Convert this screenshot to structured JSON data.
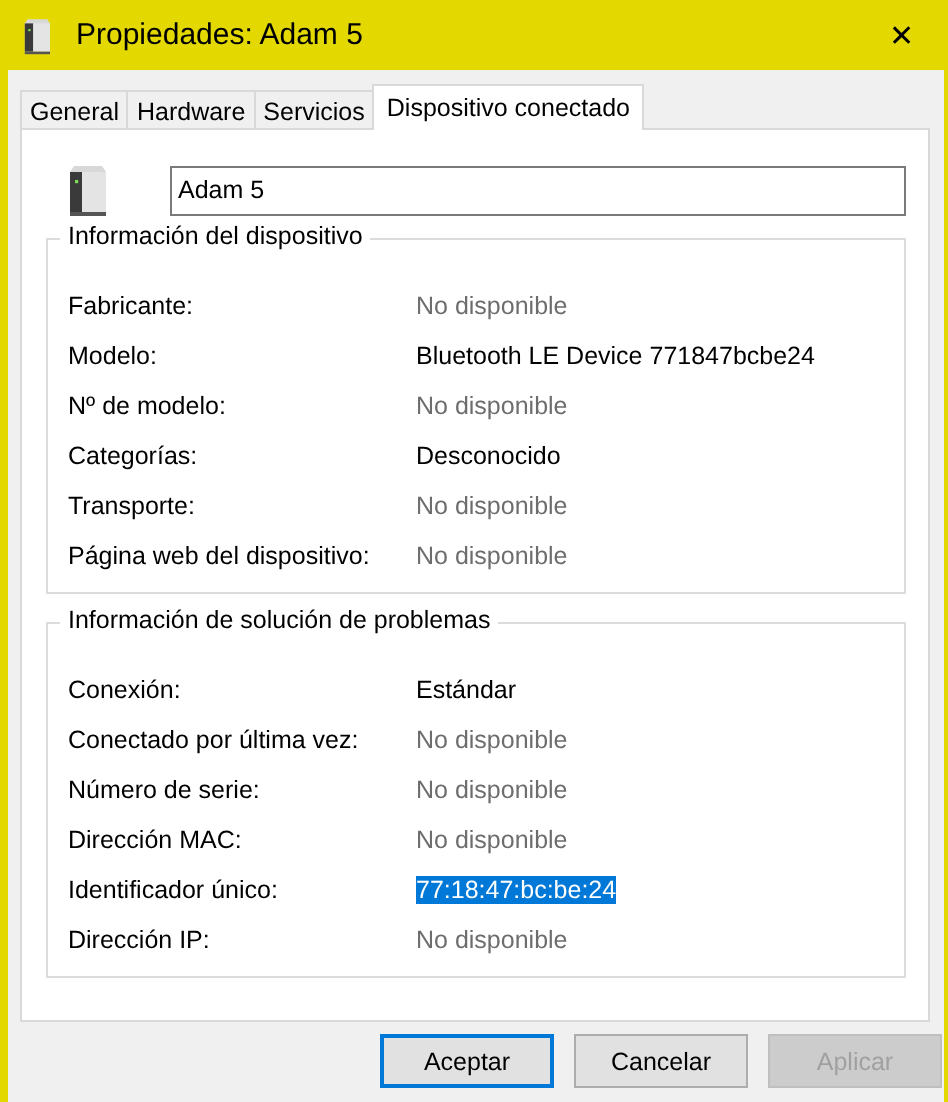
{
  "window": {
    "title": "Propiedades: Adam 5",
    "close": "✕"
  },
  "tabs": [
    {
      "label": "General",
      "selected": false
    },
    {
      "label": "Hardware",
      "selected": false
    },
    {
      "label": "Servicios",
      "selected": false
    },
    {
      "label": "Dispositivo conectado",
      "selected": true
    }
  ],
  "device_name": {
    "value": "Adam 5"
  },
  "groups": [
    {
      "title": "Información del dispositivo",
      "rows": [
        {
          "label": "Fabricante:",
          "value": "No disponible",
          "kind": "unavailable"
        },
        {
          "label": "Modelo:",
          "value": "Bluetooth LE Device 771847bcbe24",
          "kind": "text"
        },
        {
          "label": "Nº de modelo:",
          "value": "No disponible",
          "kind": "unavailable"
        },
        {
          "label": "Categorías:",
          "value": "Desconocido",
          "kind": "text"
        },
        {
          "label": "Transporte:",
          "value": "No disponible",
          "kind": "unavailable"
        },
        {
          "label": "Página web del dispositivo:",
          "value": "No disponible",
          "kind": "unavailable"
        }
      ]
    },
    {
      "title": "Información de solución de problemas",
      "rows": [
        {
          "label": "Conexión:",
          "value": "Estándar",
          "kind": "text"
        },
        {
          "label": "Conectado por última vez:",
          "value": "No disponible",
          "kind": "unavailable"
        },
        {
          "label": "Número de serie:",
          "value": "No disponible",
          "kind": "unavailable"
        },
        {
          "label": "Dirección MAC:",
          "value": "No disponible",
          "kind": "unavailable"
        },
        {
          "label": "Identificador único:",
          "value": "77:18:47:bc:be:24",
          "kind": "highlighted"
        },
        {
          "label": "Dirección IP:",
          "value": "No disponible",
          "kind": "unavailable"
        }
      ]
    }
  ],
  "buttons": [
    {
      "label": "Aceptar",
      "default": true,
      "disabled": false
    },
    {
      "label": "Cancelar",
      "default": false,
      "disabled": false
    },
    {
      "label": "Aplicar",
      "default": false,
      "disabled": true
    }
  ]
}
